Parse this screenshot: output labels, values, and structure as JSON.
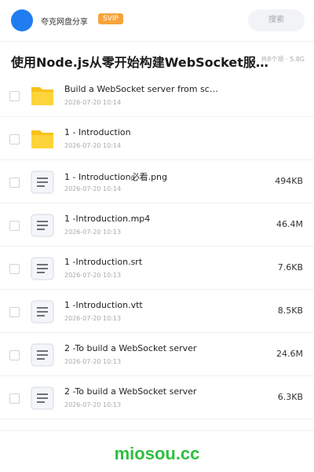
{
  "header": {
    "brand": "夸克网盘分享",
    "badge": "SVIP",
    "search_label": "搜索",
    "accent": "#1f7df0",
    "badge_color": "#f7a33a"
  },
  "share": {
    "title": "使用Node.js从零开始构建WebSocket服务器 | Build a WebSocket server from scratch using Node.js",
    "meta": "共8个项 · 5.8G"
  },
  "files": [
    {
      "icon": "folder-icon",
      "name": "Build a WebSocket server from scratch using Node.js",
      "date": "2026-07-20 10:14",
      "size": ""
    },
    {
      "icon": "folder-icon",
      "name": "1 - Introduction",
      "date": "2026-07-20 10:14",
      "size": ""
    },
    {
      "icon": "file-icon",
      "name": "1 - Introduction必看.png",
      "date": "2026-07-20 10:14",
      "size": "494KB"
    },
    {
      "icon": "file-icon",
      "name": "1 -Introduction.mp4",
      "date": "2026-07-20 10:13",
      "size": "46.4M"
    },
    {
      "icon": "file-icon",
      "name": "1 -Introduction.srt",
      "date": "2026-07-20 10:13",
      "size": "7.6KB"
    },
    {
      "icon": "file-icon",
      "name": "1 -Introduction.vtt",
      "date": "2026-07-20 10:13",
      "size": "8.5KB"
    },
    {
      "icon": "file-icon",
      "name": "2 -To build a WebSocket server",
      "date": "2026-07-20 10:13",
      "size": "24.6M"
    },
    {
      "icon": "file-icon",
      "name": "2 -To build a WebSocket server",
      "date": "2026-07-20 10:13",
      "size": "6.3KB"
    }
  ],
  "footer": {
    "brand": "miosou.cc",
    "brand_color": "#2fbf3e"
  }
}
